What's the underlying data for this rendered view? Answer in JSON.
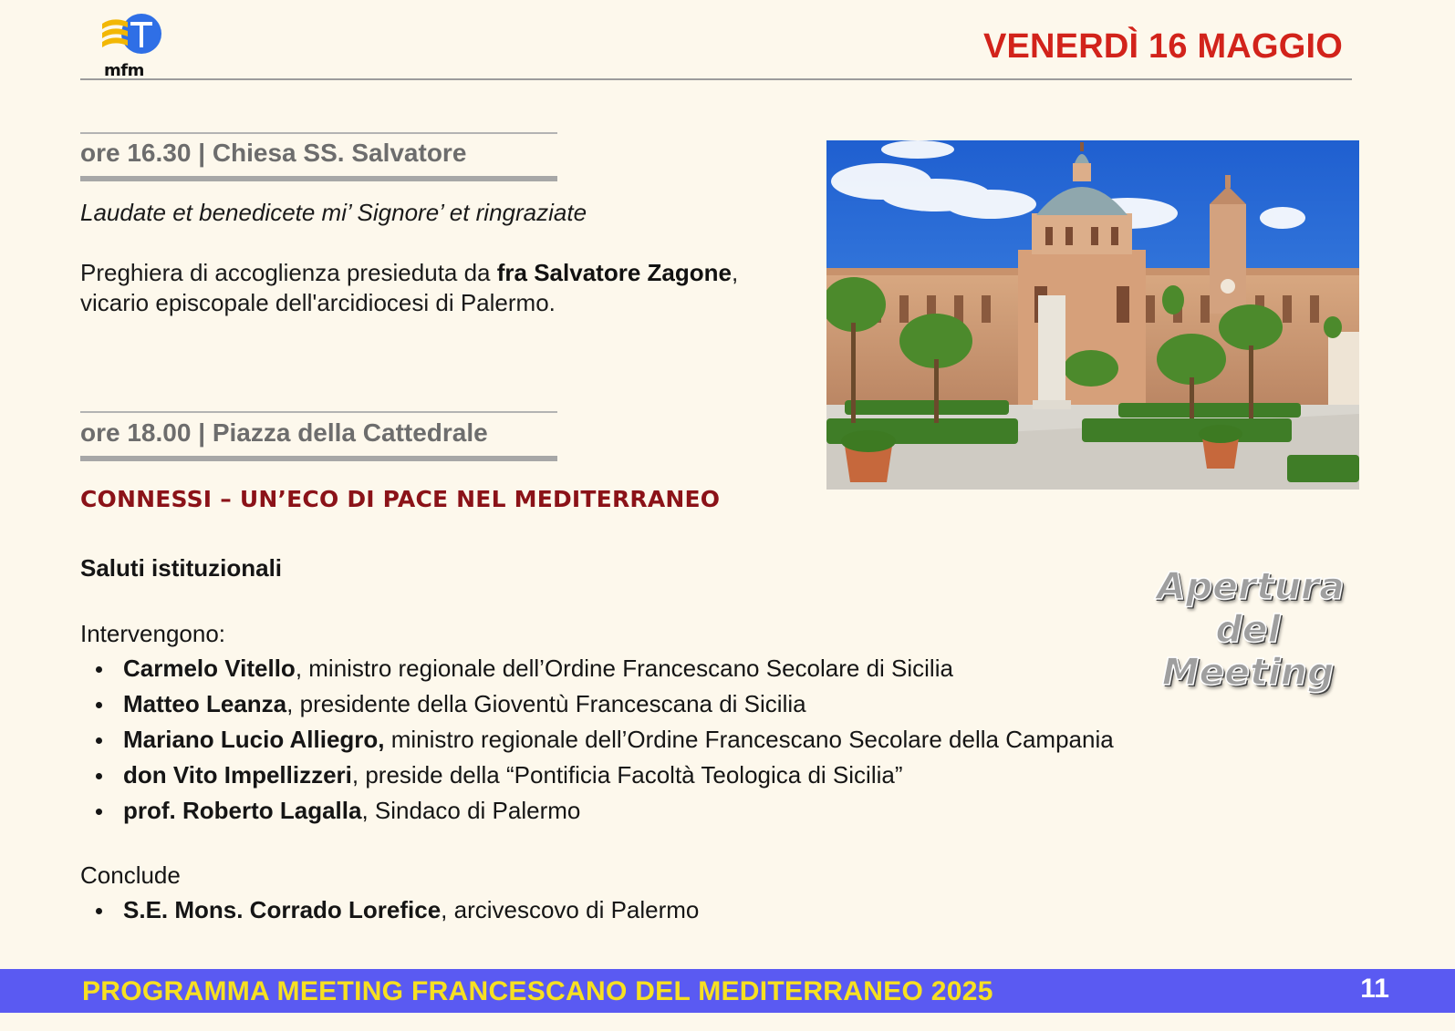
{
  "header": {
    "logo_text": "mfm",
    "date_title": "VENERDÌ 16 MAGGIO"
  },
  "section1": {
    "time_place": "ore 16.30 | Chiesa SS. Salvatore",
    "italic_title": "Laudate et benedicete mi’ Signore’ et ringraziate",
    "desc_before": "Preghiera di accoglienza presieduta da ",
    "desc_bold": "fra Salvatore Zagone",
    "desc_after": ",",
    "desc_line2": "vicario episcopale dell'arcidiocesi di Palermo."
  },
  "section2": {
    "time_place": "ore 18.00 | Piazza della Cattedrale",
    "event_title": "CONNESSI – UN’ECO DI PACE NEL MEDITERRANEO",
    "greetings": "Saluti istituzionali",
    "speakers_label": "Intervengono:",
    "speakers": [
      {
        "name": "Carmelo Vitello",
        "role": ", ministro regionale dell’Ordine Francescano Secolare di Sicilia"
      },
      {
        "name": "Matteo Leanza",
        "role": ", presidente della Gioventù Francescana di Sicilia"
      },
      {
        "name": "Mariano Lucio Alliegro,",
        "role": " ministro regionale dell’Ordine Francescano Secolare della Campania"
      },
      {
        "name": "don Vito Impellizzeri",
        "role": ", preside della “Pontificia Facoltà Teologica di Sicilia”"
      },
      {
        "name": "prof. Roberto Lagalla",
        "role": ", Sindaco di Palermo"
      }
    ],
    "closing_label": "Conclude",
    "closing": [
      {
        "name": "S.E. Mons. Corrado Lorefice",
        "role": ", arcivescovo di Palermo"
      }
    ]
  },
  "badge": {
    "line1": "Apertura",
    "line2": "del",
    "line3": "Meeting"
  },
  "footer": {
    "program_title": "PROGRAMMA MEETING FRANCESCANO DEL MEDITERRANEO 2025",
    "page_number": "11"
  },
  "colors": {
    "background": "#fdf8ec",
    "date_red": "#d2231b",
    "event_title_red": "#8b1218",
    "footer_blue": "#5a5af2",
    "footer_yellow": "#f7e021"
  }
}
